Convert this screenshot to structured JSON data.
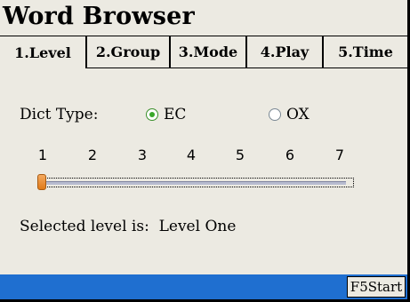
{
  "app": {
    "title": "Word Browser"
  },
  "tabs": [
    {
      "label": "1.Level",
      "active": true
    },
    {
      "label": "2.Group",
      "active": false
    },
    {
      "label": "3.Mode",
      "active": false
    },
    {
      "label": "4.Play",
      "active": false
    },
    {
      "label": "5.Time",
      "active": false
    }
  ],
  "dict": {
    "label": "Dict Type:",
    "options": [
      {
        "label": "EC",
        "selected": true
      },
      {
        "label": "OX",
        "selected": false
      }
    ]
  },
  "level": {
    "ticks": [
      "1",
      "2",
      "3",
      "4",
      "5",
      "6",
      "7"
    ],
    "current": 1,
    "min": 1,
    "max": 7,
    "selected_text": "Selected level is:  Level One"
  },
  "footer": {
    "start_label": "F5Start"
  },
  "colors": {
    "statusbar": "#1f6fd0",
    "thumb": "#e88a2e",
    "radio_on": "#39a82a"
  }
}
